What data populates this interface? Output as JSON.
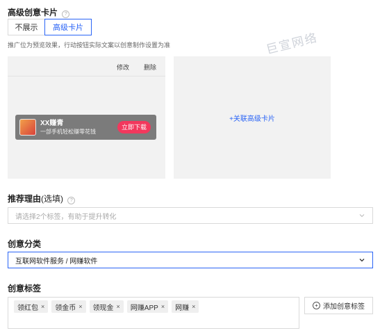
{
  "advanced_card": {
    "title": "高级创意卡片",
    "help": "?",
    "options": [
      "不展示",
      "高级卡片"
    ],
    "selected": "高级卡片",
    "hint": "推广位为预览效果，行动按钮实际文案以创意制作设置为准",
    "watermark": "巨宣网络",
    "preview": {
      "edit_label": "修改",
      "delete_label": "删除",
      "ad_title": "XX赚青",
      "ad_subtitle": "一部手机轻松赚零花钱",
      "ad_button": "立即下载"
    },
    "link_card_label": "+关联高级卡片"
  },
  "recommend_reason": {
    "title": "推荐理由",
    "optional": "(选填)",
    "help": "?",
    "placeholder": "请选择2个标签，有助于提升转化"
  },
  "category": {
    "title": "创意分类",
    "value": "互联网软件服务 / 网赚软件"
  },
  "creative_tags": {
    "title": "创意标签",
    "tags": [
      "领红包",
      "领金币",
      "领现金",
      "网赚APP",
      "网赚"
    ],
    "add_button": "添加创意标签"
  },
  "colors": {
    "accent": "#2a64f6",
    "ad_button": "#f2385d"
  }
}
